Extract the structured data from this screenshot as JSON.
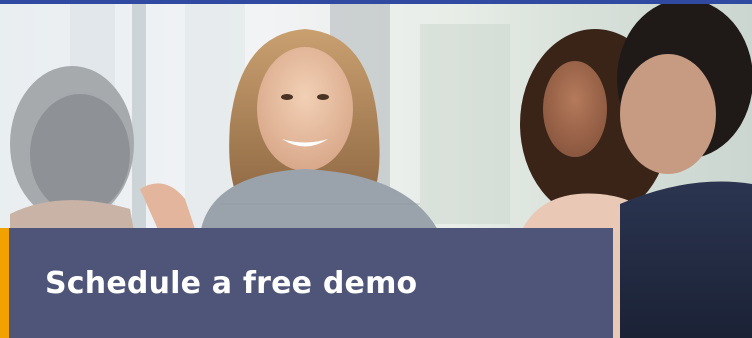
{
  "banner": {
    "cta_label": "Schedule a free demo",
    "colors": {
      "top_accent": "#2f4aa0",
      "panel": "#4f5578",
      "left_accent": "#f2a200",
      "text": "#ffffff"
    }
  }
}
